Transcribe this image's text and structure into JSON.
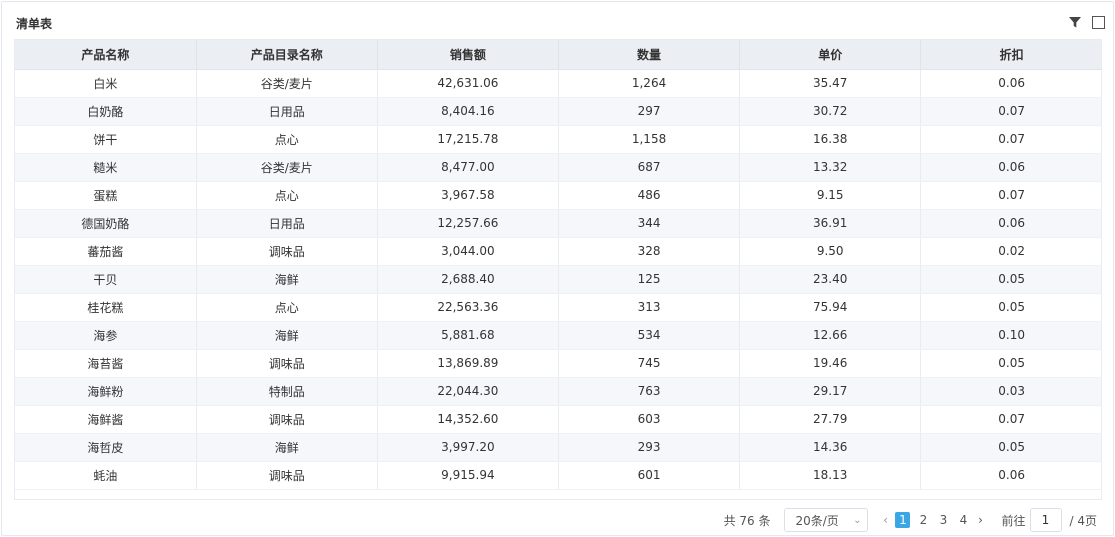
{
  "widget": {
    "title": "清单表"
  },
  "icons": {
    "filter": "filter-icon",
    "maximize": "maximize-icon"
  },
  "table": {
    "columns": [
      "产品名称",
      "产品目录名称",
      "销售额",
      "数量",
      "单价",
      "折扣"
    ],
    "rows": [
      [
        "白米",
        "谷类/麦片",
        "42,631.06",
        "1,264",
        "35.47",
        "0.06"
      ],
      [
        "白奶酪",
        "日用品",
        "8,404.16",
        "297",
        "30.72",
        "0.07"
      ],
      [
        "饼干",
        "点心",
        "17,215.78",
        "1,158",
        "16.38",
        "0.07"
      ],
      [
        "糙米",
        "谷类/麦片",
        "8,477.00",
        "687",
        "13.32",
        "0.06"
      ],
      [
        "蛋糕",
        "点心",
        "3,967.58",
        "486",
        "9.15",
        "0.07"
      ],
      [
        "德国奶酪",
        "日用品",
        "12,257.66",
        "344",
        "36.91",
        "0.06"
      ],
      [
        "蕃茄酱",
        "调味品",
        "3,044.00",
        "328",
        "9.50",
        "0.02"
      ],
      [
        "干贝",
        "海鲜",
        "2,688.40",
        "125",
        "23.40",
        "0.05"
      ],
      [
        "桂花糕",
        "点心",
        "22,563.36",
        "313",
        "75.94",
        "0.05"
      ],
      [
        "海参",
        "海鲜",
        "5,881.68",
        "534",
        "12.66",
        "0.10"
      ],
      [
        "海苔酱",
        "调味品",
        "13,869.89",
        "745",
        "19.46",
        "0.05"
      ],
      [
        "海鲜粉",
        "特制品",
        "22,044.30",
        "763",
        "29.17",
        "0.03"
      ],
      [
        "海鲜酱",
        "调味品",
        "14,352.60",
        "603",
        "27.79",
        "0.07"
      ],
      [
        "海哲皮",
        "海鲜",
        "3,997.20",
        "293",
        "14.36",
        "0.05"
      ],
      [
        "蚝油",
        "调味品",
        "9,915.94",
        "601",
        "18.13",
        "0.06"
      ]
    ]
  },
  "pagination": {
    "total": "共 76 条",
    "page_size": "20条/页",
    "pages": [
      "1",
      "2",
      "3",
      "4"
    ],
    "current_page": "1",
    "goto_label": "前往",
    "goto_value": "1",
    "pages_suffix": "/ 4页",
    "active_color": "#3aa6e5"
  }
}
